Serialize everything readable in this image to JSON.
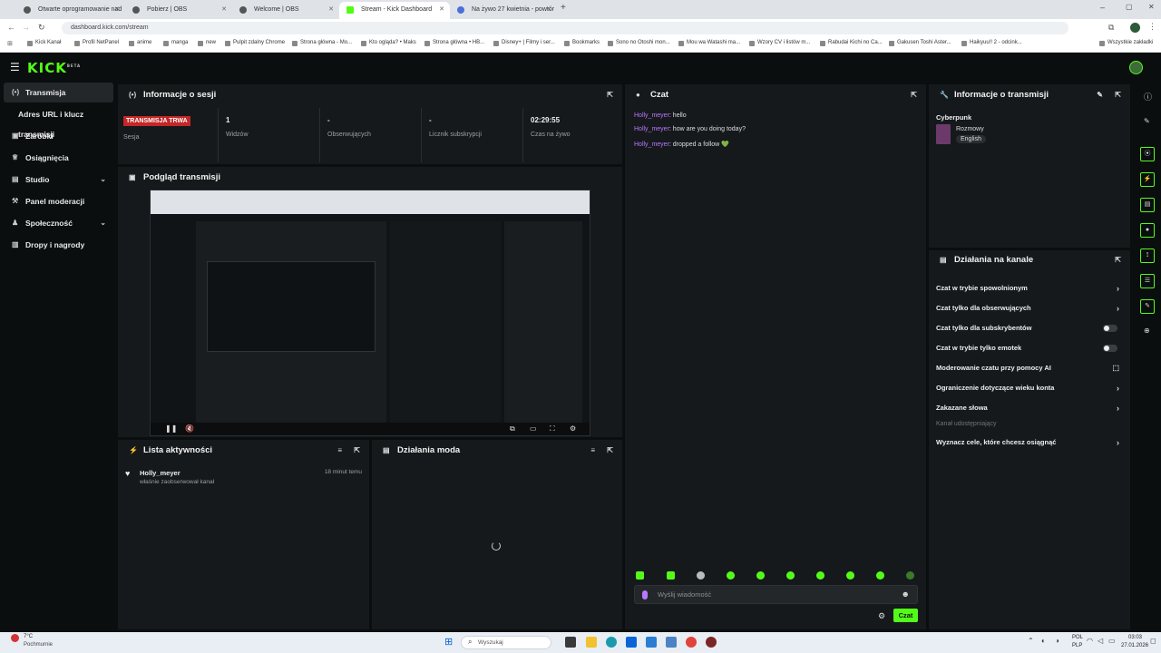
{
  "browser": {
    "tabs": [
      {
        "title": "Otwarte oprogramowanie nad"
      },
      {
        "title": "Pobierz | OBS"
      },
      {
        "title": "Welcome | OBS"
      },
      {
        "title": "Stream - Kick Dashboard"
      },
      {
        "title": "Na żywo 27 kwietnia - powtór"
      }
    ],
    "url": "dashboard.kick.com/stream",
    "bookmarks": [
      "Kick Kanał",
      "Profil NetPanel",
      "anime",
      "manga",
      "new",
      "Pulpit zdalny Chrome",
      "Strona główna - Mo...",
      "Kto ogląda? • Maks",
      "Strona główna • HB...",
      "Disney+ | Filmy i ser...",
      "Bookmarks",
      "Sono no Otoshi mon...",
      "Mou wa Watashi ma...",
      "Wzory CV i listów m...",
      "Rabudai Kichi no Ca...",
      "Gakusen Toshi Aster...",
      "Haikyuu!! 2 - odcink..."
    ],
    "bookmarks_right": "Wszystkie zakładki"
  },
  "app": {
    "logo": "KICK",
    "logo_badge": "BETA",
    "sidebar": [
      {
        "label": "Transmisja",
        "icon": "broadcast-icon"
      },
      {
        "label": "Adres URL i klucz transmisji",
        "icon": ""
      },
      {
        "label": "Zarobki",
        "icon": "earnings-icon"
      },
      {
        "label": "Osiągnięcia",
        "icon": "trophy-icon"
      },
      {
        "label": "Studio",
        "icon": "studio-icon"
      },
      {
        "label": "Panel moderacji",
        "icon": "moderation-icon"
      },
      {
        "label": "Społeczność",
        "icon": "community-icon"
      },
      {
        "label": "Dropy i nagrody",
        "icon": "gift-icon"
      }
    ],
    "session": {
      "title": "Informacje o sesji",
      "live_badge": "TRANSMISJA TRWA",
      "session_label": "Sesja",
      "stats": [
        {
          "value": "1",
          "label": "Widzów"
        },
        {
          "value": "-",
          "label": "Obserwujących"
        },
        {
          "value": "-",
          "label": "Licznik subskrypcji"
        },
        {
          "value": "02:29:55",
          "label": "Czas na żywo"
        }
      ]
    },
    "preview": {
      "title": "Podgląd transmisji"
    },
    "activity": {
      "title": "Lista aktywności",
      "items": [
        {
          "user": "Holly_meyer",
          "text": "właśnie zaobserwował kanał",
          "time": "18 minut temu"
        }
      ]
    },
    "mod_actions": {
      "title": "Działania moda"
    },
    "chat": {
      "title": "Czat",
      "messages": [
        {
          "user": "Holly_meyer",
          "text": ": hello"
        },
        {
          "user": "Holly_meyer",
          "text": ": how are you doing today?"
        },
        {
          "user": "Holly_meyer",
          "text": ": dropped a follow 💚"
        }
      ],
      "input_placeholder": "Wyślij wiadomość",
      "send_label": "Czat"
    },
    "stream_info": {
      "title": "Informacje o transmisji",
      "category": "Cyberpunk",
      "tags": [
        "Rozmowy",
        "English"
      ]
    },
    "channel_actions": {
      "title": "Działania na kanale",
      "items": [
        {
          "label": "Czat w trybie spowolnionym",
          "control": "chevron"
        },
        {
          "label": "Czat tylko dla obserwujących",
          "control": "chevron"
        },
        {
          "label": "Czat tylko dla subskrybentów",
          "control": "toggle"
        },
        {
          "label": "Czat w trybie tylko emotek",
          "control": "toggle"
        },
        {
          "label": "Moderowanie czatu przy pomocy AI",
          "control": "chart"
        },
        {
          "label": "Ograniczenie dotyczące wieku konta",
          "control": "chevron"
        },
        {
          "label": "Zakazane słowa",
          "control": "chevron"
        }
      ],
      "shared_label": "Kanał udostępniający",
      "goal_label": "Wyznacz cele, które chcesz osiągnąć"
    }
  },
  "taskbar": {
    "weather_temp": "7°C",
    "weather_desc": "Pochmurnie",
    "search_placeholder": "Wyszukaj",
    "lang": "POL",
    "lang2": "PLP",
    "time": "03:03",
    "date": "27.01.2026"
  }
}
